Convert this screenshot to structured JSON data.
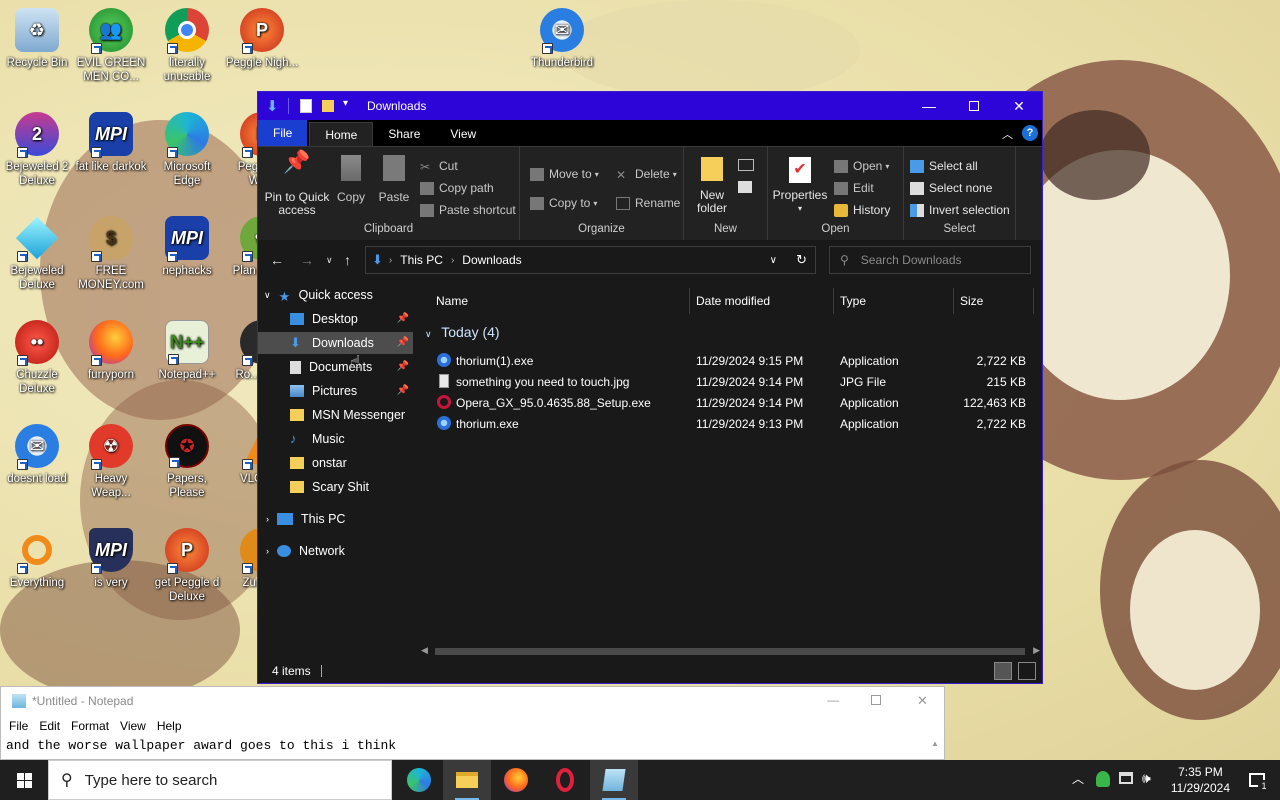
{
  "desktop": {
    "icons": [
      {
        "label": "Recycle Bin"
      },
      {
        "label": "EVIL GREEN MEN CO..."
      },
      {
        "label": "literally unusable"
      },
      {
        "label": "Peggle Nigh..."
      },
      {
        "label": "Thunderbird"
      },
      {
        "label": "Bejeweled 2 Deluxe"
      },
      {
        "label": "fat like darkok"
      },
      {
        "label": "Microsoft Edge"
      },
      {
        "label": "Peggle of Wa..."
      },
      {
        "label": "Bejeweled Deluxe"
      },
      {
        "label": "FREE MONEY.com"
      },
      {
        "label": "nephacks"
      },
      {
        "label": "Plan Zom..."
      },
      {
        "label": "Chuzzle Deluxe"
      },
      {
        "label": "furryporn"
      },
      {
        "label": "Notepad++"
      },
      {
        "label": "Ro... Ma..."
      },
      {
        "label": "doesnt load"
      },
      {
        "label": "Heavy Weap..."
      },
      {
        "label": "Papers, Please"
      },
      {
        "label": "VLC pl..."
      },
      {
        "label": "Everything"
      },
      {
        "label": "is very"
      },
      {
        "label": "get Peggle d Deluxe"
      },
      {
        "label": "Zuma..."
      }
    ]
  },
  "explorer": {
    "title": "Downloads",
    "tabs": [
      "File",
      "Home",
      "Share",
      "View"
    ],
    "ribbon": {
      "clipboard": {
        "pin": "Pin to Quick access",
        "copy": "Copy",
        "paste": "Paste",
        "cut": "Cut",
        "copy_path": "Copy path",
        "paste_shortcut": "Paste shortcut",
        "label": "Clipboard"
      },
      "organize": {
        "move_to": "Move to",
        "copy_to": "Copy to",
        "delete": "Delete",
        "rename": "Rename",
        "label": "Organize"
      },
      "new": {
        "new_folder": "New folder",
        "label": "New"
      },
      "open": {
        "properties": "Properties",
        "open": "Open",
        "edit": "Edit",
        "history": "History",
        "label": "Open"
      },
      "select": {
        "select_all": "Select all",
        "select_none": "Select none",
        "invert": "Invert selection",
        "label": "Select"
      }
    },
    "address": {
      "crumbs": [
        "This PC",
        "Downloads"
      ],
      "search_placeholder": "Search Downloads"
    },
    "nav": {
      "quick_access": "Quick access",
      "items": [
        {
          "label": "Desktop",
          "pinned": true
        },
        {
          "label": "Downloads",
          "pinned": true
        },
        {
          "label": "Documents",
          "pinned": true
        },
        {
          "label": "Pictures",
          "pinned": true
        },
        {
          "label": "MSN Messenger",
          "pinned": false
        },
        {
          "label": "Music",
          "pinned": false
        },
        {
          "label": "onstar",
          "pinned": false
        },
        {
          "label": "Scary Shit",
          "pinned": false
        }
      ],
      "this_pc": "This PC",
      "network": "Network"
    },
    "columns": {
      "name": "Name",
      "date": "Date modified",
      "type": "Type",
      "size": "Size"
    },
    "group_label": "Today (4)",
    "files": [
      {
        "name": "thorium(1).exe",
        "date": "11/29/2024 9:15 PM",
        "type": "Application",
        "size": "2,722 KB",
        "icon": "thorium-icon"
      },
      {
        "name": "something you need to touch.jpg",
        "date": "11/29/2024 9:14 PM",
        "type": "JPG File",
        "size": "215 KB",
        "icon": "jpg-file-icon"
      },
      {
        "name": "Opera_GX_95.0.4635.88_Setup.exe",
        "date": "11/29/2024 9:14 PM",
        "type": "Application",
        "size": "122,463 KB",
        "icon": "opera-gx-icon"
      },
      {
        "name": "thorium.exe",
        "date": "11/29/2024 9:13 PM",
        "type": "Application",
        "size": "2,722 KB",
        "icon": "thorium-icon"
      }
    ],
    "status": "4 items",
    "colors": {
      "titlebar": "#2d05d8",
      "background": "#191919",
      "selected": "#4d4d4d"
    }
  },
  "notepad": {
    "title": "*Untitled - Notepad",
    "menu": [
      "File",
      "Edit",
      "Format",
      "View",
      "Help"
    ],
    "text": "and the worse wallpaper award goes to this i think"
  },
  "taskbar": {
    "search_placeholder": "Type here to search",
    "apps": [
      "edge-icon",
      "file-explorer-icon",
      "firefox-icon",
      "opera-icon",
      "notepad-icon"
    ],
    "time": "7:35 PM",
    "date": "11/29/2024",
    "notification_count": "1"
  }
}
